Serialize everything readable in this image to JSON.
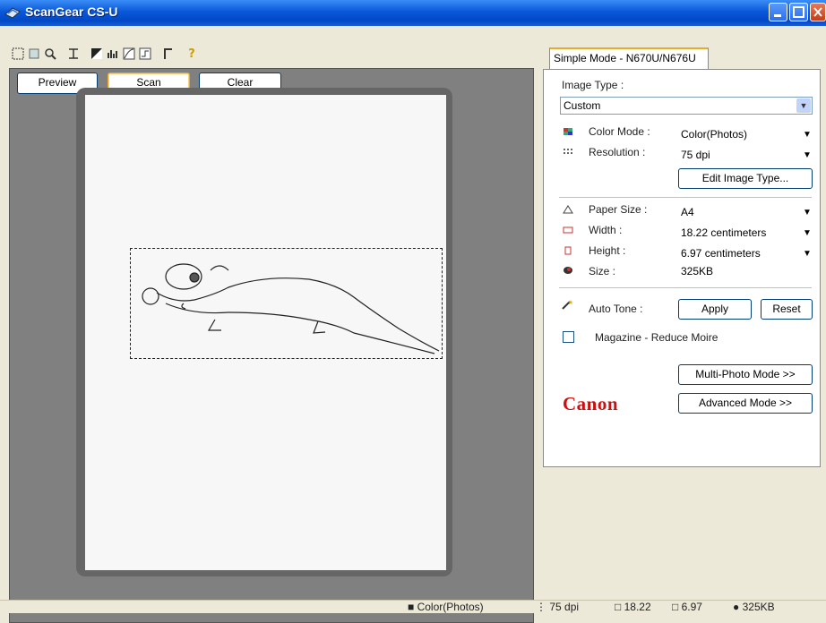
{
  "window": {
    "title": "ScanGear CS-U"
  },
  "left": {
    "preview_label": "Preview",
    "scan_label": "Scan",
    "clear_label": "Clear"
  },
  "tab": {
    "label": "Simple Mode - N670U/N676U"
  },
  "image_type": {
    "label": "Image Type :",
    "value": "Custom"
  },
  "color_mode": {
    "label": "Color Mode :",
    "value": "Color(Photos)"
  },
  "resolution": {
    "label": "Resolution :",
    "value": "75 dpi"
  },
  "edit_button": "Edit Image Type...",
  "paper_size": {
    "label": "Paper Size :",
    "value": "A4"
  },
  "width": {
    "label": "Width :",
    "value": "18.22 centimeters"
  },
  "height": {
    "label": "Height :",
    "value": "6.97 centimeters"
  },
  "size": {
    "label": "Size :",
    "value": "325KB"
  },
  "auto_tone": {
    "label": "Auto Tone :",
    "apply": "Apply",
    "reset": "Reset"
  },
  "magazine": {
    "label": "Magazine - Reduce Moire"
  },
  "multi_photo": "Multi-Photo Mode >>",
  "advanced": "Advanced Mode >>",
  "logo": "Canon",
  "statusbar": {
    "color": "Color(Photos)",
    "dpi": "75 dpi",
    "w": "18.22",
    "h": "6.97",
    "size": "325KB"
  }
}
